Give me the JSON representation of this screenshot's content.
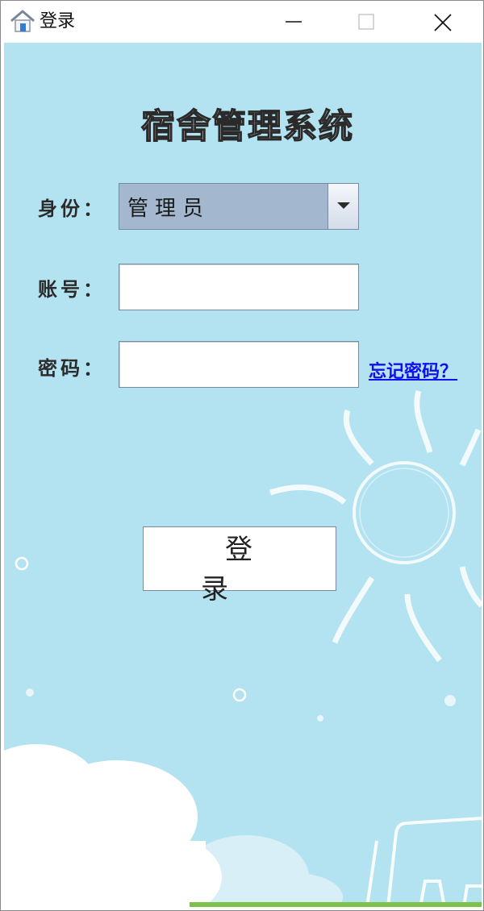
{
  "window": {
    "title": "登录",
    "controls": [
      "minimize-icon",
      "maximize-icon",
      "close-icon"
    ]
  },
  "app": {
    "title": "宿舍管理系统"
  },
  "form": {
    "role_label": "身份：",
    "role_value": "管理员",
    "account_label": "账号：",
    "account_value": "",
    "password_label": "密码：",
    "password_value": "",
    "forgot_link": "忘记密码？",
    "login_button": "登　录"
  },
  "colors": {
    "background": "#b3e2f0",
    "combo_fill": "#a3b8cf",
    "link": "#1010ee"
  }
}
